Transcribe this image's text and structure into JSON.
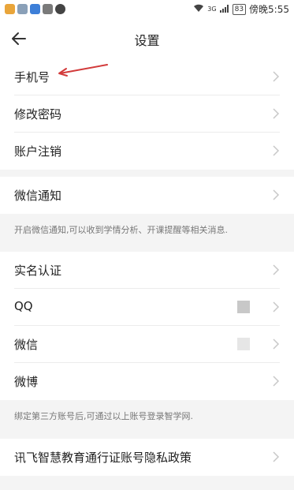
{
  "statusbar": {
    "battery": "83",
    "time": "傍晚5:55",
    "network": "3G"
  },
  "header": {
    "title": "设置"
  },
  "account_section": {
    "items": [
      {
        "label": "手机号"
      },
      {
        "label": "修改密码"
      },
      {
        "label": "账户注销"
      }
    ]
  },
  "wechat_section": {
    "item": {
      "label": "微信通知"
    },
    "note": "开启微信通知,可以收到学情分析、开课提醒等相关消息."
  },
  "bind_section": {
    "items": [
      {
        "label": "实名认证"
      },
      {
        "label": "QQ"
      },
      {
        "label": "微信"
      },
      {
        "label": "微博"
      }
    ],
    "note": "绑定第三方账号后,可通过以上账号登录智学网."
  },
  "policy_section": {
    "item": {
      "label": "讯飞智慧教育通行证账号隐私政策"
    }
  },
  "colors": {
    "annotation_arrow": "#d23a3a",
    "qq_toggle": "#c8c8c8",
    "wechat_toggle": "#e6e6e6"
  }
}
